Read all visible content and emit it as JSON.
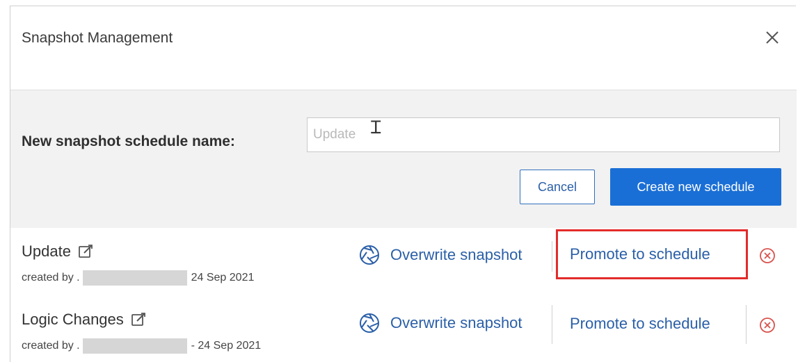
{
  "dialog": {
    "title": "Snapshot Management"
  },
  "form": {
    "label": "New snapshot schedule name:",
    "input_value": "Update",
    "cancel_label": "Cancel",
    "create_label": "Create new schedule"
  },
  "snapshots": [
    {
      "name": "Update",
      "created_prefix": "created by .",
      "date": "24 Sep 2021",
      "overwrite_label": "Overwrite snapshot",
      "promote_label": "Promote to schedule",
      "highlighted": true
    },
    {
      "name": "Logic Changes",
      "created_prefix": "created by .",
      "date": "- 24 Sep 2021",
      "overwrite_label": "Overwrite snapshot",
      "promote_label": "Promote to schedule",
      "highlighted": false
    }
  ],
  "colors": {
    "accent": "#1a6fd6",
    "link": "#2a5fa8",
    "highlight": "#e32b2b",
    "remove": "#d9534f"
  },
  "icons": {
    "close": "close-icon",
    "edit": "edit-icon",
    "overwrite": "aperture-icon",
    "remove": "remove-circle-icon"
  }
}
